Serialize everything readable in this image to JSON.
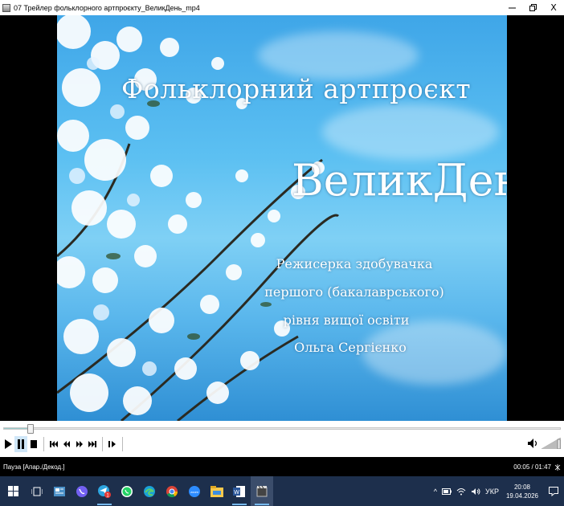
{
  "window": {
    "title": "07 Трейлер фольклорного артпроєкту_ВеликДень_mp4",
    "controls": {
      "minimize_icon": "minimize-icon",
      "maximize_icon": "restore-icon",
      "close_icon": "close-icon",
      "close_label": "X"
    }
  },
  "video": {
    "title_line1": "Фольклорний артпроєкт",
    "title_line2": "ВеликДень",
    "credit_lines": [
      "Режисерка здобувачка",
      "першого (бакалаврського)",
      "рівня вищої освіти",
      "Ольга Сергієнко"
    ],
    "colors": {
      "sky_top": "#3fa6e8",
      "sky_mid": "#7fd0f5",
      "text": "#ffffff"
    }
  },
  "player": {
    "progress_fraction": 0.047,
    "buttons": [
      "play-icon",
      "pause-icon",
      "stop-icon",
      "skip-back-icon",
      "rewind-icon",
      "fast-forward-icon",
      "skip-forward-icon",
      "frame-step-icon"
    ],
    "volume_icon": "speaker-icon",
    "volume_level": 0.9
  },
  "status": {
    "left_text": "Пауза [Апар./Декод.]",
    "time_text": "00:05 / 01:47"
  },
  "taskbar": {
    "icons": [
      "windows-start-icon",
      "task-view-icon",
      "news-widget-icon",
      "viber-icon",
      "telegram-icon",
      "whatsapp-icon",
      "edge-icon",
      "chrome-icon",
      "zoom-icon",
      "file-explorer-icon",
      "word-icon",
      "media-player-icon"
    ],
    "telegram_badge": "1",
    "zoom_label": "zoom",
    "tray_chevron": "^",
    "language": "УКР",
    "clock_time": "20:08",
    "clock_date": "19.04.2026"
  }
}
